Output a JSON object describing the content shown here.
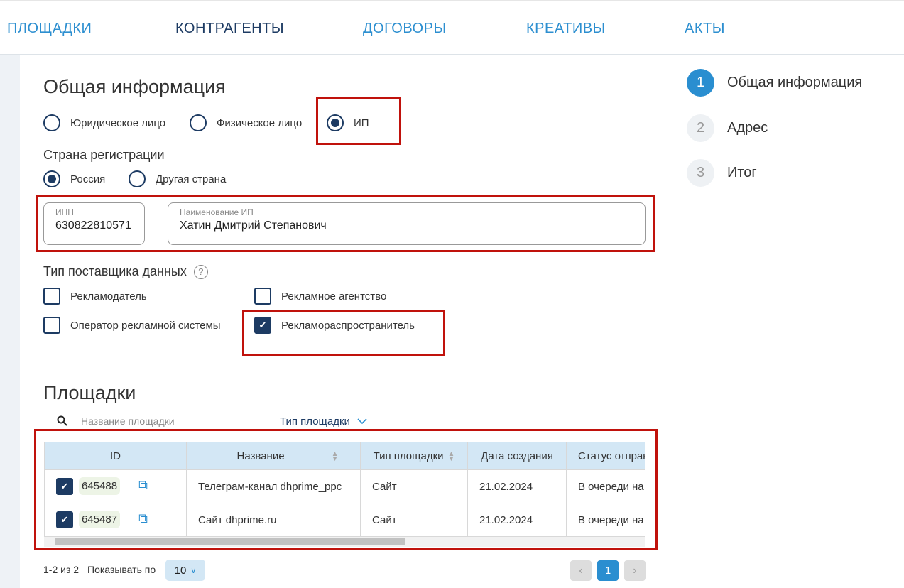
{
  "nav": {
    "items": [
      "ПЛОЩАДКИ",
      "КОНТРАГЕНТЫ",
      "ДОГОВОРЫ",
      "КРЕАТИВЫ",
      "АКТЫ"
    ]
  },
  "steps": [
    {
      "num": "1",
      "label": "Общая информация"
    },
    {
      "num": "2",
      "label": "Адрес"
    },
    {
      "num": "3",
      "label": "Итог"
    }
  ],
  "general": {
    "title": "Общая информация",
    "entity_types": [
      "Юридическое лицо",
      "Физическое лицо",
      "ИП"
    ],
    "country_label": "Страна регистрации",
    "countries": [
      "Россия",
      "Другая страна"
    ],
    "inn_label": "ИНН",
    "inn_value": "630822810571",
    "name_label": "Наименование ИП",
    "name_value": "Хатин Дмитрий Степанович",
    "provider_label": "Тип поставщика данных",
    "help": "?",
    "provider_types": [
      "Рекламодатель",
      "Рекламное агентство",
      "Оператор рекламной системы",
      "Рекламораспространитель"
    ]
  },
  "platforms": {
    "title": "Площадки",
    "search_placeholder": "Название площадки",
    "type_filter": "Тип площадки",
    "columns": [
      "ID",
      "Название",
      "Тип площадки",
      "Дата создания",
      "Статус отправки"
    ],
    "rows": [
      {
        "id": "645488",
        "name": "Телеграм-канал dhprime_ppc",
        "type": "Сайт",
        "date": "21.02.2024",
        "status": "В очереди на отправку"
      },
      {
        "id": "645487",
        "name": "Сайт dhprime.ru",
        "type": "Сайт",
        "date": "21.02.2024",
        "status": "В очереди на отправку"
      }
    ],
    "range": "1-2 из 2",
    "show_label": "Показывать по",
    "page_size": "10",
    "page": "1"
  },
  "colors": {
    "accent": "#2a8ed0",
    "navy": "#1d3b63",
    "highlight": "#c0120c"
  }
}
